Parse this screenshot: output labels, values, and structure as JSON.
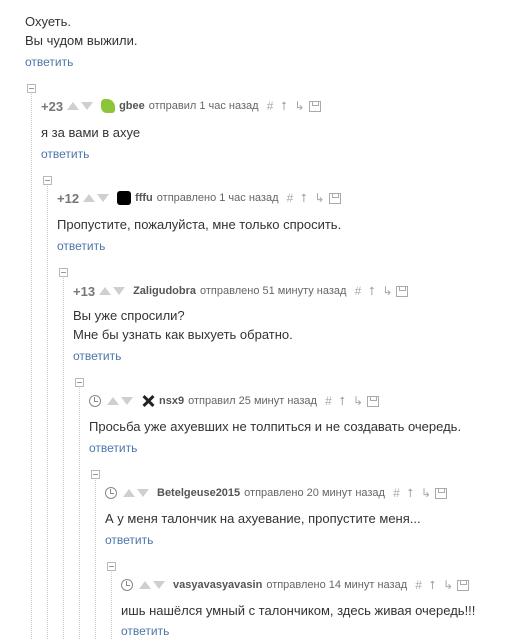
{
  "comments": [
    {
      "lines": [
        "Охуеть.",
        "Вы чудом выжили."
      ],
      "reply": "ответить"
    },
    {
      "rating": "+23",
      "author": "gbee",
      "time": "отправил 1 час назад",
      "lines": [
        "я за вами в ахуе"
      ],
      "reply": "ответить"
    },
    {
      "rating": "+12",
      "author": "fffu",
      "time": "отправлено 1 час назад",
      "lines": [
        "Пропустите, пожалуйста, мне только спросить."
      ],
      "reply": "ответить"
    },
    {
      "rating": "+13",
      "author": "Zaligudobra",
      "time": "отправлено 51 минуту назад",
      "lines": [
        "Вы уже спросили?",
        "Мне бы узнать как выхуеть обратно."
      ],
      "reply": "ответить"
    },
    {
      "author": "nsx9",
      "time": "отправил 25 минут назад",
      "lines": [
        "Просьба уже ахуевших не толпиться и не создавать очередь."
      ],
      "reply": "ответить"
    },
    {
      "author": "Betelgeuse2015",
      "time": "отправлено 20 минут назад",
      "lines": [
        "А у меня талончик на ахуевание, пропустите меня..."
      ],
      "reply": "ответить"
    },
    {
      "author": "vasyavasyavasin",
      "time": "отправлено 14 минут назад",
      "lines": [
        "ишь нашёлся умный с талончиком, здесь живая очередь!!!"
      ],
      "reply": "ответить"
    }
  ],
  "icons": {
    "hash": "#",
    "up": "⭡",
    "branch": "↳"
  }
}
